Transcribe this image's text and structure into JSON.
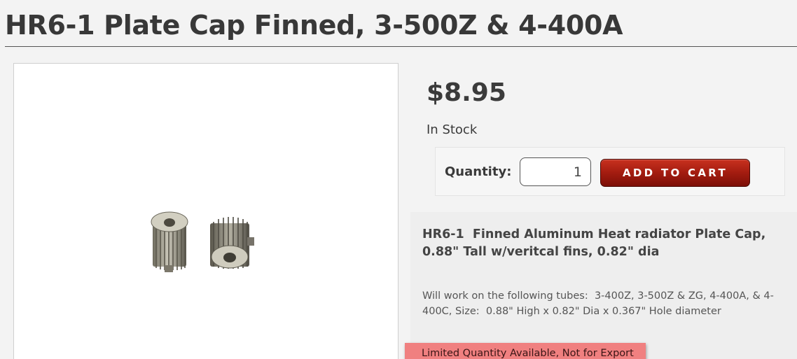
{
  "product": {
    "title": "HR6-1 Plate Cap Finned, 3-500Z & 4-400A",
    "price": "$8.95",
    "stock_status": "In Stock",
    "image_icon": "finned-plate-cap-photo"
  },
  "cart": {
    "quantity_label": "Quantity:",
    "quantity_value": "1",
    "add_to_cart_label": "ADD TO CART",
    "button_color": "#a31c10"
  },
  "description": {
    "heading": "HR6-1  Finned Aluminum Heat radiator Plate Cap, 0.88\" Tall w/veritcal fins, 0.82\" dia",
    "body": "Will work on the following tubes:  3-400Z, 3-500Z & ZG, 4-400A, & 4-400C, Size:  0.88\" High x 0.82\" Dia x 0.367\" Hole diameter"
  },
  "notice": {
    "text": "Limited Quantity Available, Not for Export",
    "color": "#f08080"
  }
}
